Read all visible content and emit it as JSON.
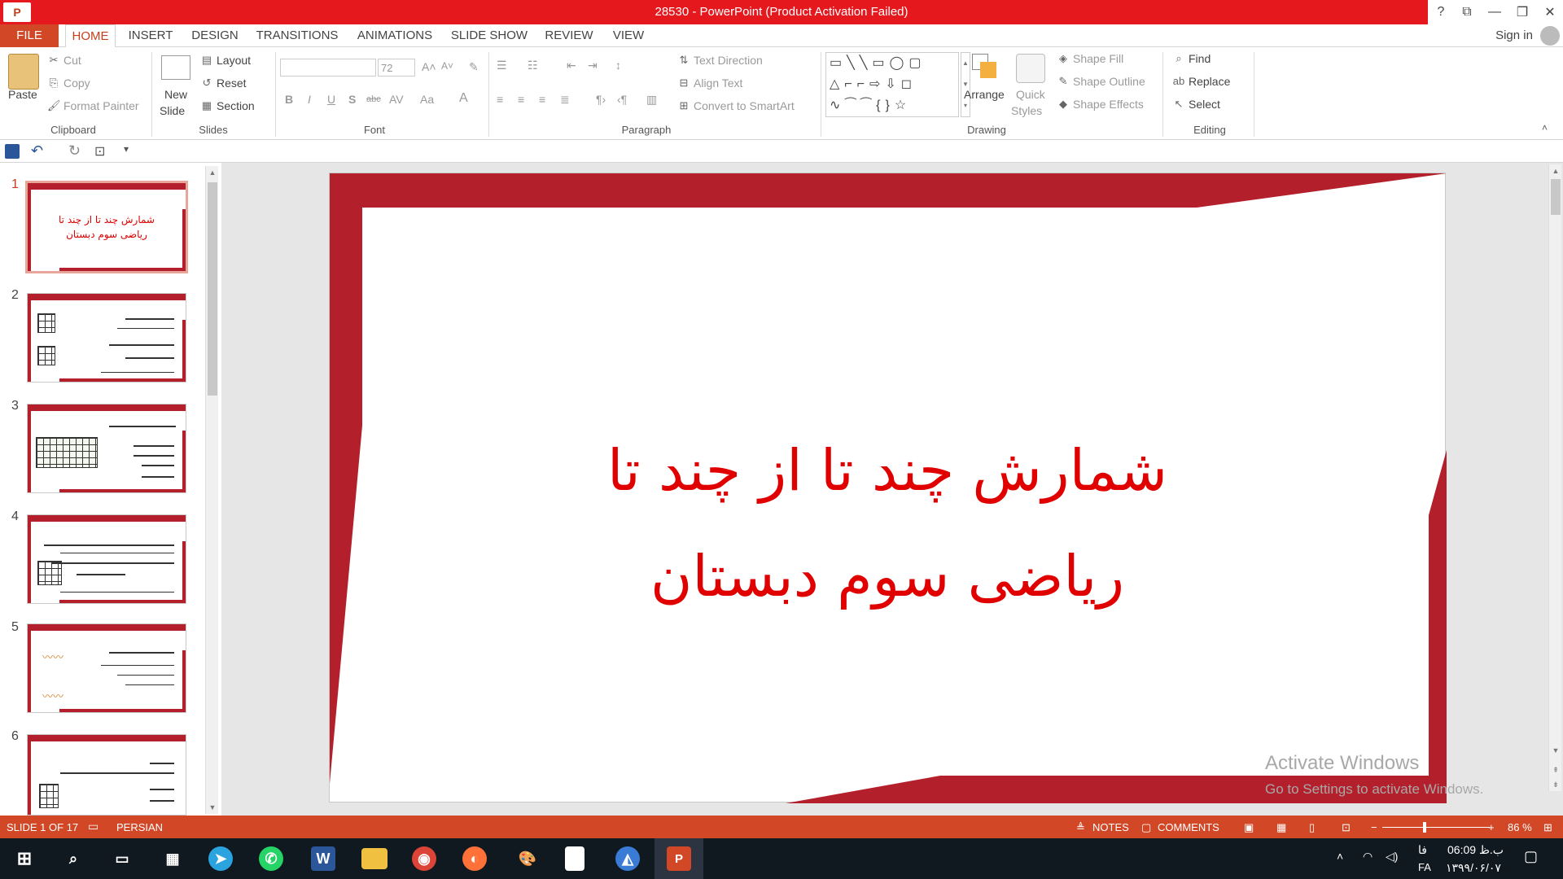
{
  "window": {
    "title": "28530 - PowerPoint (Product Activation Failed)",
    "help": "?",
    "sign_in": "Sign in"
  },
  "tabs": [
    "FILE",
    "HOME",
    "INSERT",
    "DESIGN",
    "TRANSITIONS",
    "ANIMATIONS",
    "SLIDE SHOW",
    "REVIEW",
    "VIEW"
  ],
  "ribbon": {
    "clipboard": {
      "paste": "Paste",
      "cut": "Cut",
      "copy": "Copy",
      "format_painter": "Format Painter",
      "label": "Clipboard"
    },
    "slides": {
      "new_slide_1": "New",
      "new_slide_2": "Slide",
      "layout": "Layout",
      "reset": "Reset",
      "section": "Section",
      "label": "Slides"
    },
    "font": {
      "size": "72",
      "label": "Font",
      "bold": "B",
      "italic": "I",
      "underline": "U",
      "shadow": "S",
      "strike": "abc",
      "spacing": "AV",
      "case": "Aa",
      "color": "A"
    },
    "paragraph": {
      "text_direction": "Text Direction",
      "align_text": "Align Text",
      "convert_smartart": "Convert to SmartArt",
      "label": "Paragraph"
    },
    "drawing": {
      "arrange": "Arrange",
      "quick_styles_1": "Quick",
      "quick_styles_2": "Styles",
      "shape_fill": "Shape Fill",
      "shape_outline": "Shape Outline",
      "shape_effects": "Shape Effects",
      "label": "Drawing"
    },
    "editing": {
      "find": "Find",
      "replace": "Replace",
      "select": "Select",
      "label": "Editing"
    }
  },
  "thumbnails": [
    {
      "num": "1",
      "text": "شمارش چند تا از چند تا\nریاضی سوم دبستان"
    },
    {
      "num": "2"
    },
    {
      "num": "3"
    },
    {
      "num": "4"
    },
    {
      "num": "5"
    },
    {
      "num": "6"
    }
  ],
  "slide": {
    "title_line1": "شمارش چند تا از چند تا",
    "title_line2": "ریاضی سوم دبستان",
    "frame_color": "#b3202c",
    "title_color": "#e00000"
  },
  "watermark": {
    "line1": "Activate Windows",
    "line2": "Go to Settings to activate Windows."
  },
  "status": {
    "slide_of": "SLIDE 1 OF 17",
    "language": "PERSIAN",
    "notes": "NOTES",
    "comments": "COMMENTS",
    "zoom": "86 %"
  },
  "taskbar": {
    "time": "06:09 ب.ظ",
    "date": "۱۳۹۹/۰۶/۰۷",
    "lang": "FA",
    "keyboard": "فا"
  },
  "colors": {
    "accent": "#d24726",
    "title_red": "#e5181e"
  }
}
